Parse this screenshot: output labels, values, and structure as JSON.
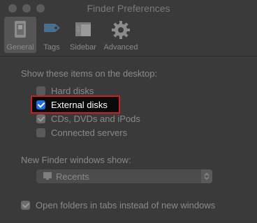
{
  "window": {
    "title": "Finder Preferences"
  },
  "toolbar": {
    "tabs": [
      {
        "label": "General",
        "icon": "switch-icon",
        "active": true
      },
      {
        "label": "Tags",
        "icon": "tag-icon",
        "active": false
      },
      {
        "label": "Sidebar",
        "icon": "sidebar-icon",
        "active": false
      },
      {
        "label": "Advanced",
        "icon": "gear-icon",
        "active": false
      }
    ]
  },
  "desktop_items": {
    "heading": "Show these items on the desktop:",
    "items": [
      {
        "label": "Hard disks",
        "checked": false
      },
      {
        "label": "External disks",
        "checked": true
      },
      {
        "label": "CDs, DVDs and iPods",
        "checked": true
      },
      {
        "label": "Connected servers",
        "checked": false
      }
    ]
  },
  "new_window": {
    "heading": "New Finder windows show:",
    "selected": "Recents"
  },
  "tabs_option": {
    "label": "Open folders in tabs instead of new windows",
    "checked": true
  },
  "colors": {
    "highlight_border": "#c8201f",
    "checkbox_accent": "#1f6fe0"
  }
}
